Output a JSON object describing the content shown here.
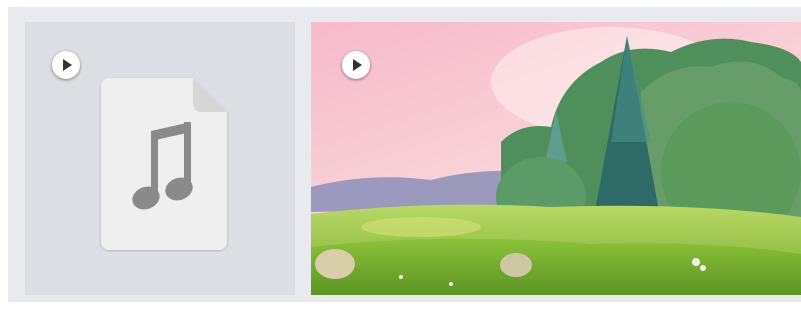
{
  "media": [
    {
      "kind": "audio",
      "icons": {
        "play": "play-icon",
        "file": "audio-file-icon",
        "note": "music-note-icon"
      },
      "colors": {
        "tile": "#dcdee3",
        "file": "#efefef",
        "note": "#8a8a8a"
      }
    },
    {
      "kind": "video",
      "icons": {
        "play": "play-icon",
        "thumbnail": "video-thumbnail"
      },
      "colors": {
        "sky": "#f5c6d4",
        "grass": "#8fc23c",
        "trees": "#3d7a4f"
      }
    }
  ]
}
